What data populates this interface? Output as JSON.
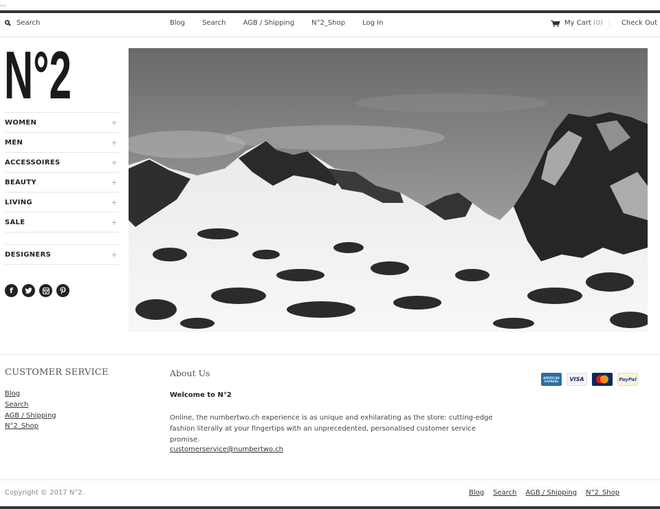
{
  "top": {
    "ellipsis": "..."
  },
  "header": {
    "search_label": "Search",
    "nav": [
      "Blog",
      "Search",
      "AGB / Shipping",
      "N°2_Shop",
      "Log In"
    ],
    "cart_label": "My Cart",
    "cart_count": "(0)",
    "checkout_label": "Check Out"
  },
  "sidebar": {
    "logo_text": "N°2",
    "menu": [
      {
        "label": "WOMEN",
        "icon": "+"
      },
      {
        "label": "MEN",
        "icon": "+"
      },
      {
        "label": "ACCESSOIRES",
        "icon": "+"
      },
      {
        "label": "BEAUTY",
        "icon": "+"
      },
      {
        "label": "LIVING",
        "icon": "+"
      },
      {
        "label": "SALE",
        "icon": "+"
      }
    ],
    "designers": {
      "label": "DESIGNERS",
      "icon": "+"
    },
    "social": [
      "facebook-icon",
      "twitter-icon",
      "instagram-icon",
      "pinterest-icon"
    ]
  },
  "hero": {
    "alt": "Black and white snowy mountain landscape"
  },
  "footer": {
    "customer_service_title": "CUSTOMER SERVICE",
    "customer_service_links": [
      "Blog",
      "Search",
      "AGB / Shipping",
      "N°2_Shop"
    ],
    "about_title": "About Us",
    "welcome": "Welcome to N°2",
    "about_text": "Online, the numbertwo.ch experience is as unique and exhilarating as the store: cutting-edge fashion literally at your fingertips with an unprecedented, personalised customer service promise.",
    "email": "customerservice@numbertwo.ch",
    "payments": [
      "American Express",
      "VISA",
      "MasterCard",
      "PayPal"
    ],
    "payment_labels": {
      "amex": "AMERICAN EXPRESS",
      "visa": "VISA",
      "paypal": "PayPal"
    },
    "copyright": "Copyright © 2017 N°2.",
    "bottom_links": [
      "Blog",
      "Search",
      "AGB / Shipping",
      "N°2_Shop"
    ]
  }
}
